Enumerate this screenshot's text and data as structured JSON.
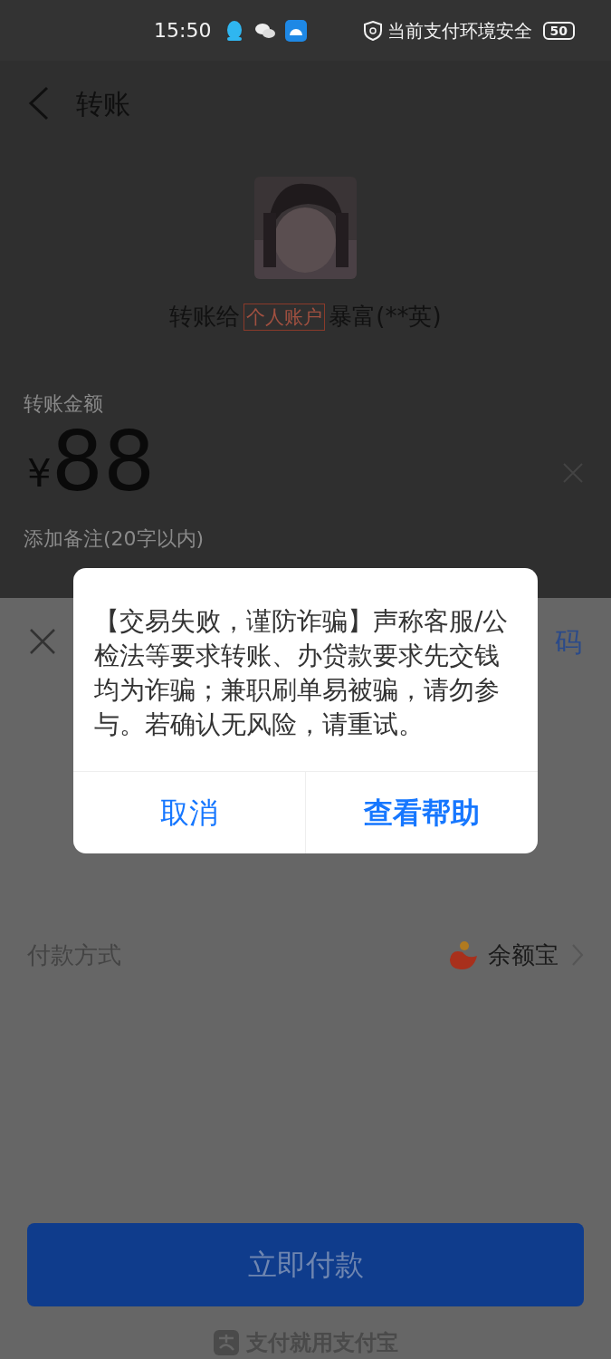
{
  "status_bar": {
    "time": "15:50",
    "security_text": "当前支付环境安全",
    "battery": "50"
  },
  "header": {
    "title": "转账"
  },
  "recipient": {
    "prefix": "转账给",
    "tag": "个人账户",
    "name": "暴富(**英)"
  },
  "amount": {
    "label": "转账金额",
    "currency": "¥",
    "value": "88"
  },
  "remark": {
    "placeholder": "添加备注(20字以内)"
  },
  "sheet": {
    "partial_text": "码",
    "payment_label": "付款方式",
    "payment_value": "余额宝",
    "pay_button": "立即付款",
    "footer": "支付就用支付宝"
  },
  "dialog": {
    "message": "【交易失败，谨防诈骗】声称客服/公检法等要求转账、办贷款要求先交钱均为诈骗；兼职刷单易被骗，请勿参与。若确认无风险，请重试。",
    "buttons": [
      {
        "label": "取消",
        "kind": "secondary"
      },
      {
        "label": "查看帮助",
        "kind": "primary"
      }
    ]
  }
}
